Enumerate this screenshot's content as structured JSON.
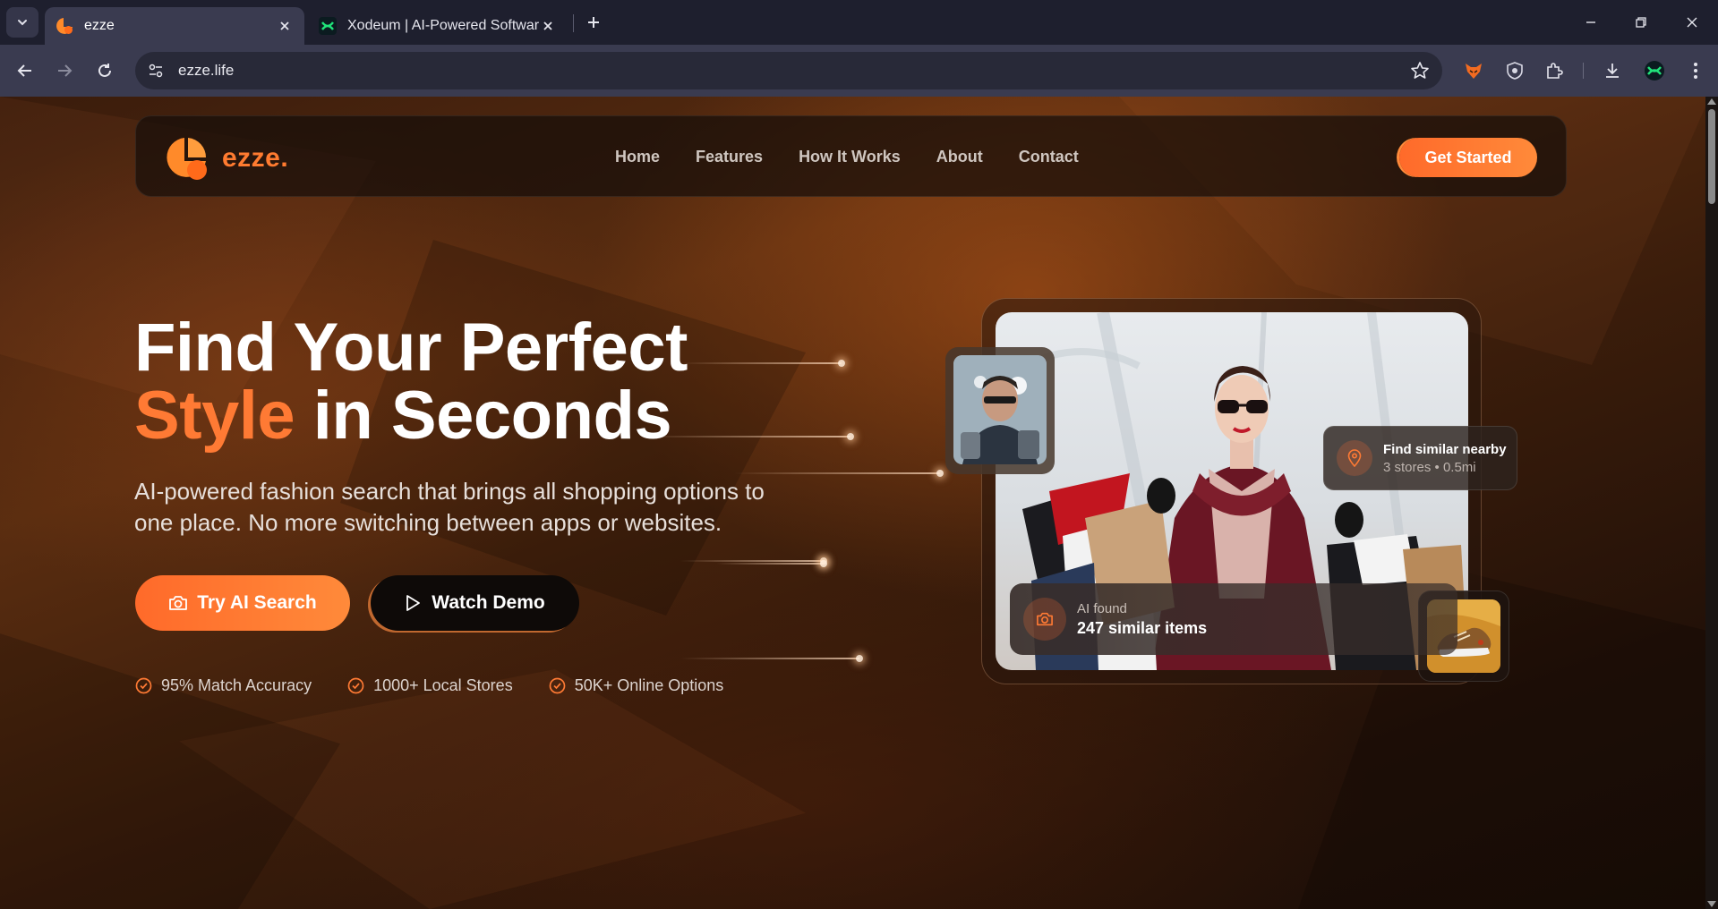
{
  "browser": {
    "tabs": [
      {
        "title": "ezze",
        "active": true
      },
      {
        "title": "Xodeum | AI-Powered Software",
        "active": false
      }
    ],
    "address": "ezze.life"
  },
  "site": {
    "logo_text": "ezze.",
    "nav": [
      "Home",
      "Features",
      "How It Works",
      "About",
      "Contact"
    ],
    "cta": "Get Started"
  },
  "hero": {
    "title_line1": "Find Your Perfect",
    "title_accent": "Style",
    "title_line2_rest": " in Seconds",
    "subtitle": "AI-powered fashion search that brings all shopping options to one place. No more switching between apps or websites.",
    "primary_button": "Try AI Search",
    "secondary_button": "Watch Demo",
    "stats": [
      "95% Match Accuracy",
      "1000+ Local Stores",
      "50K+ Online Options"
    ]
  },
  "showcase": {
    "nearby_title": "Find similar nearby",
    "nearby_detail": "3 stores • 0.5mi",
    "found_label": "AI found",
    "found_value": "247 similar items"
  },
  "colors": {
    "accent": "#ff7a34",
    "tabbar": "#1e1f2e",
    "toolbar": "#3a3b50"
  }
}
